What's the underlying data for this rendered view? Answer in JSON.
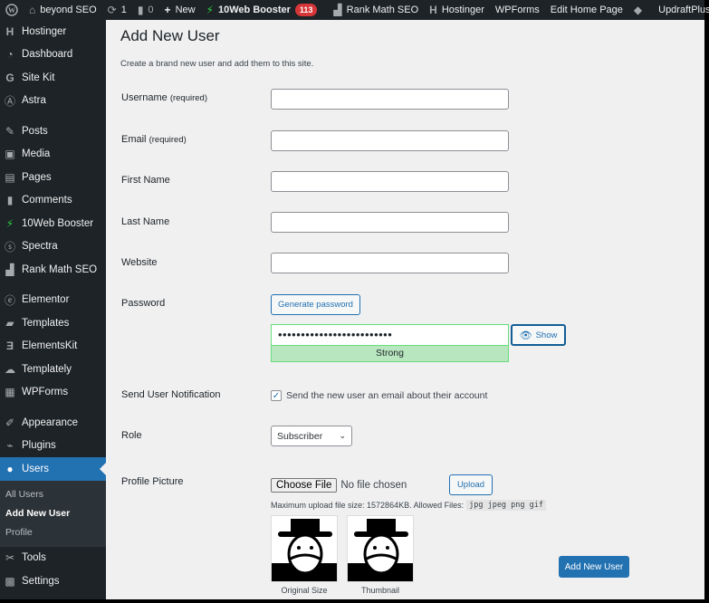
{
  "adminbar": {
    "site_name": "beyond SEO",
    "updates_count": "1",
    "comments_count": "0",
    "new_label": "New",
    "booster_label": "10Web Booster",
    "booster_badge": "113",
    "rankmath_label": "Rank Math SEO",
    "hostinger_label": "Hostinger",
    "wpforms_label": "WPForms",
    "edit_home_label": "Edit Home Page",
    "updraft_label": "UpdraftPlus"
  },
  "sidebar": {
    "items": [
      {
        "label": "Hostinger",
        "icon": "hostinger-icon"
      },
      {
        "label": "Dashboard",
        "icon": "dashboard-icon"
      },
      {
        "label": "Site Kit",
        "icon": "google-icon"
      },
      {
        "label": "Astra",
        "icon": "astra-icon"
      },
      {
        "label": "Posts",
        "icon": "pin-icon"
      },
      {
        "label": "Media",
        "icon": "media-icon"
      },
      {
        "label": "Pages",
        "icon": "pages-icon"
      },
      {
        "label": "Comments",
        "icon": "comment-icon"
      },
      {
        "label": "10Web Booster",
        "icon": "booster-icon"
      },
      {
        "label": "Spectra",
        "icon": "spectra-icon"
      },
      {
        "label": "Rank Math SEO",
        "icon": "rankmath-icon"
      },
      {
        "label": "Elementor",
        "icon": "elementor-icon"
      },
      {
        "label": "Templates",
        "icon": "folder-icon"
      },
      {
        "label": "ElementsKit",
        "icon": "elementskit-icon"
      },
      {
        "label": "Templately",
        "icon": "templately-icon"
      },
      {
        "label": "WPForms",
        "icon": "wpforms-icon"
      },
      {
        "label": "Appearance",
        "icon": "brush-icon"
      },
      {
        "label": "Plugins",
        "icon": "plug-icon"
      },
      {
        "label": "Users",
        "icon": "user-icon"
      },
      {
        "label": "Tools",
        "icon": "wrench-icon"
      },
      {
        "label": "Settings",
        "icon": "settings-icon"
      }
    ],
    "submenu": [
      "All Users",
      "Add New User",
      "Profile"
    ]
  },
  "main": {
    "title": "Add New User",
    "description": "Create a brand new user and add them to this site.",
    "fields": {
      "username": {
        "label": "Username",
        "note": "(required)",
        "value": ""
      },
      "email": {
        "label": "Email",
        "note": "(required)",
        "value": ""
      },
      "first_name": {
        "label": "First Name",
        "value": ""
      },
      "last_name": {
        "label": "Last Name",
        "value": ""
      },
      "website": {
        "label": "Website",
        "value": ""
      }
    },
    "password": {
      "label": "Password",
      "generate_label": "Generate password",
      "masked_value": "•••••••••••••••••••••••••",
      "strength": "Strong",
      "show_label": "Show"
    },
    "notification": {
      "label": "Send User Notification",
      "checkbox_label": "Send the new user an email about their account",
      "checked": true
    },
    "role": {
      "label": "Role",
      "selected": "Subscriber"
    },
    "profile_picture": {
      "label": "Profile Picture",
      "choose_label": "Choose File",
      "no_file": "No file chosen",
      "upload_label": "Upload",
      "note": "Maximum upload file size: 1572864KB. Allowed Files:",
      "allowed": "jpg jpeg png gif",
      "captions": [
        "Original Size",
        "Thumbnail"
      ]
    },
    "submit_label": "Add New User"
  },
  "colors": {
    "accent": "#2271b1",
    "adminbar_bg": "#1d2327",
    "strength_bg": "#b8e6bf",
    "badge": "#d63638"
  }
}
